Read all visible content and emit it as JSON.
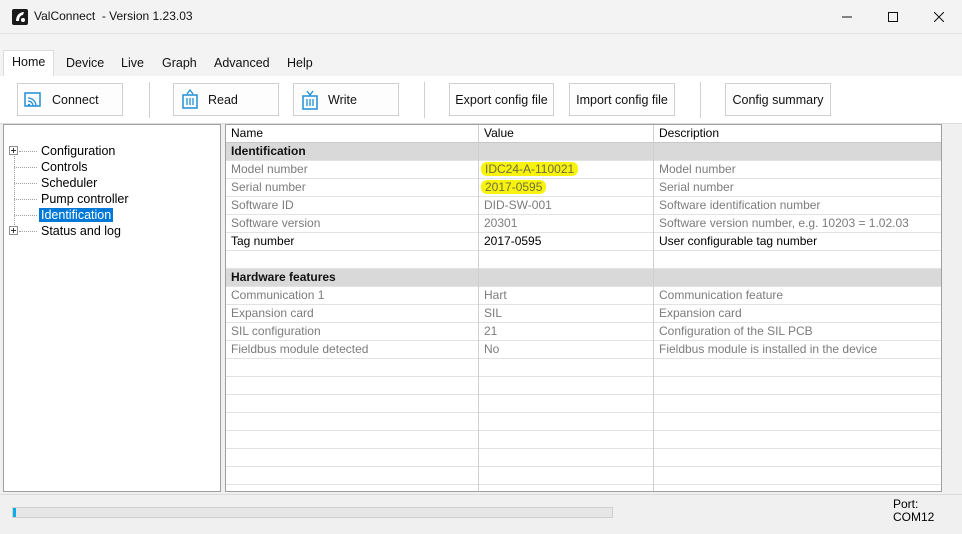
{
  "window": {
    "title": "ValConnect  - Version 1.23.03",
    "app_icon": "valconnect-logo",
    "controls": [
      "minimize",
      "maximize",
      "close"
    ]
  },
  "menu": {
    "tabs": [
      {
        "label": "Home",
        "active": true
      },
      {
        "label": "Device"
      },
      {
        "label": "Live"
      },
      {
        "label": "Graph"
      },
      {
        "label": "Advanced"
      },
      {
        "label": "Help"
      }
    ]
  },
  "toolbar": {
    "connect_label": "Connect",
    "read_label": "Read",
    "write_label": "Write",
    "export_label": "Export config file",
    "import_label": "Import config file",
    "summary_label": "Config summary"
  },
  "tree": {
    "items": [
      {
        "label": "Configuration",
        "expandable": true
      },
      {
        "label": "Controls"
      },
      {
        "label": "Scheduler"
      },
      {
        "label": "Pump controller"
      },
      {
        "label": "Identification",
        "selected": true
      },
      {
        "label": "Status and log",
        "expandable": true
      }
    ]
  },
  "grid": {
    "columns": [
      "Name",
      "Value",
      "Description"
    ],
    "rows": [
      {
        "type": "section",
        "name": "Identification"
      },
      {
        "name": "Model number",
        "value": "IDC24-A-110021",
        "description": "Model number",
        "readonly": true,
        "highlight": true
      },
      {
        "name": "Serial number",
        "value": "2017-0595",
        "description": "Serial number",
        "readonly": true,
        "highlight": true
      },
      {
        "name": "Software ID",
        "value": "DID-SW-001",
        "description": "Software identification number",
        "readonly": true
      },
      {
        "name": "Software version",
        "value": "20301",
        "description": "Software version number, e.g. 10203 = 1.02.03",
        "readonly": true
      },
      {
        "name": "Tag number",
        "value": "2017-0595",
        "description": "User configurable tag number",
        "readonly": false
      },
      {
        "type": "blank"
      },
      {
        "type": "section",
        "name": "Hardware features"
      },
      {
        "name": "Communication 1",
        "value": "Hart",
        "description": "Communication feature",
        "readonly": true
      },
      {
        "name": "Expansion card",
        "value": "SIL",
        "description": "Expansion card",
        "readonly": true
      },
      {
        "name": "SIL configuration",
        "value": "21",
        "description": "Configuration of the SIL PCB",
        "readonly": true
      },
      {
        "name": "Fieldbus module detected",
        "value": "No",
        "description": "Fieldbus module is installed in the device",
        "readonly": true
      }
    ],
    "highlight_color": "#f7f20e"
  },
  "status": {
    "progress": 0.005,
    "progress_color": "#06b0e6",
    "port_label": "Port:",
    "port_value": "COM12"
  }
}
